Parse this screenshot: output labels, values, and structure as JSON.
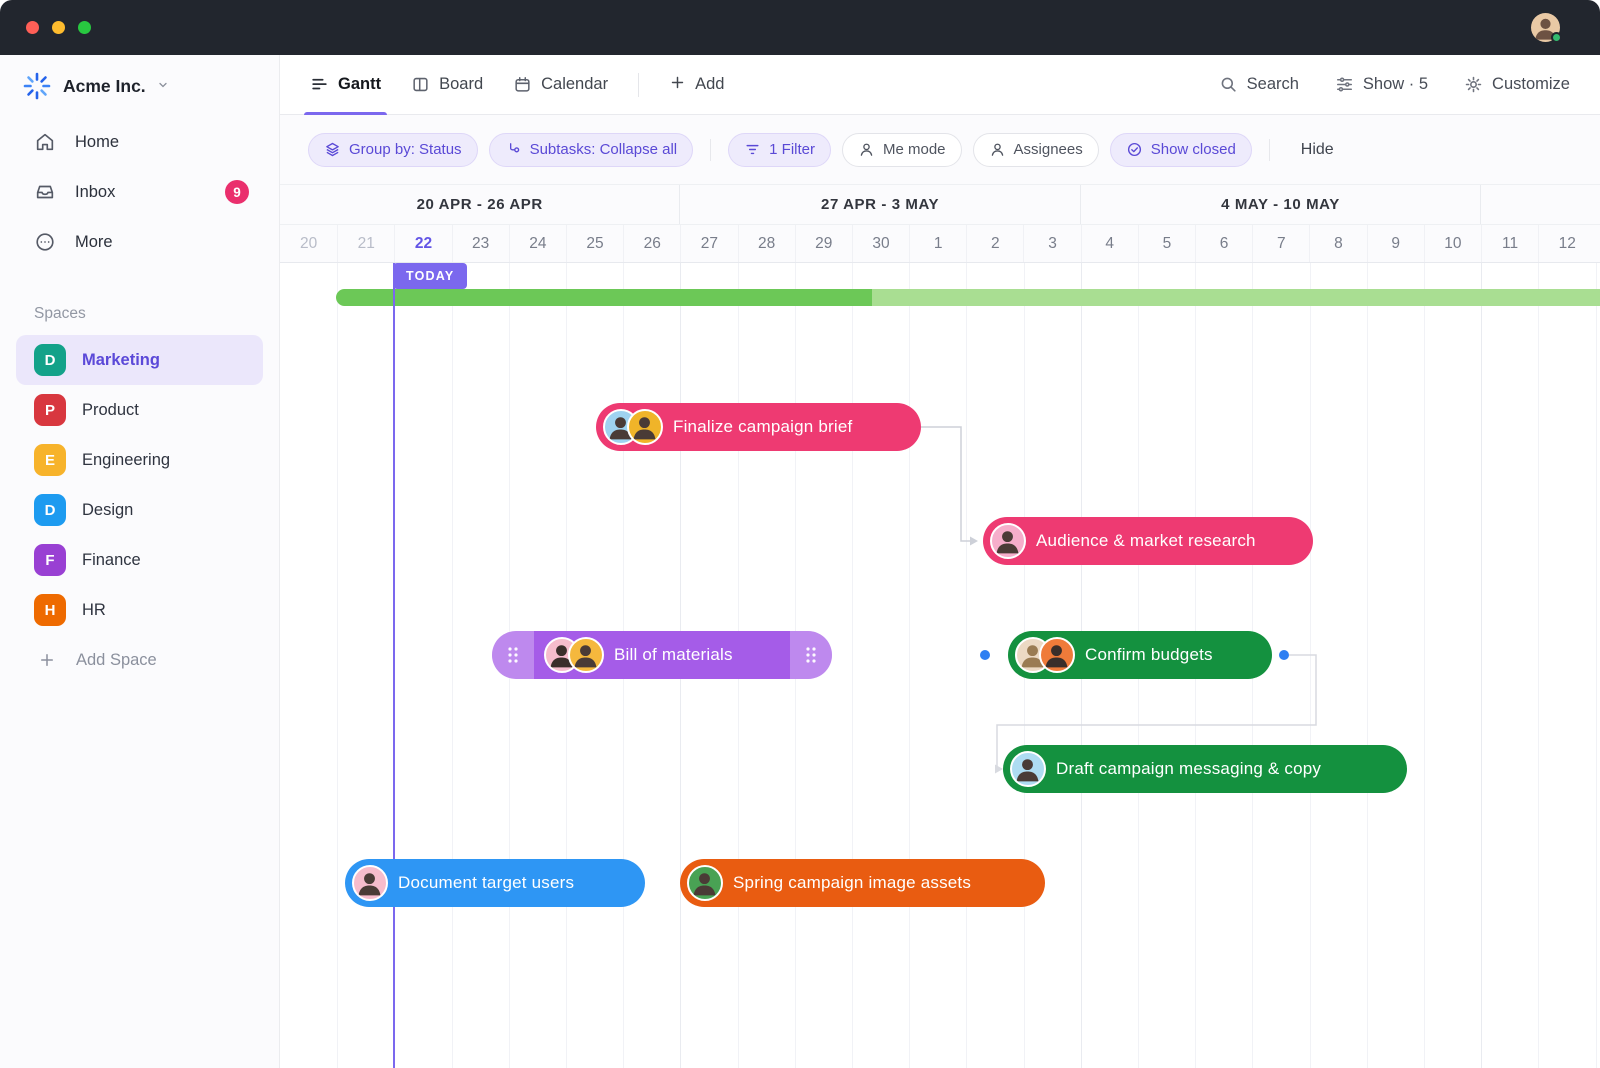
{
  "window": {
    "titlebar_color": "#22262e",
    "traffic_lights": [
      "close",
      "minimize",
      "zoom"
    ],
    "user": {
      "avatar_icon": "user-avatar",
      "online_status_color": "#34b96f"
    }
  },
  "sidebar": {
    "workspace_name": "Acme Inc.",
    "nav": [
      {
        "label": "Home",
        "icon": "home-icon"
      },
      {
        "label": "Inbox",
        "icon": "inbox-icon",
        "badge": "9"
      },
      {
        "label": "More",
        "icon": "ellipsis-circle-icon"
      }
    ],
    "spaces_heading": "Spaces",
    "spaces": [
      {
        "label": "Marketing",
        "initial": "D",
        "color": "#13a289",
        "selected": true
      },
      {
        "label": "Product",
        "initial": "P",
        "color": "#d8373f",
        "selected": false
      },
      {
        "label": "Engineering",
        "initial": "E",
        "color": "#f7b32b",
        "selected": false
      },
      {
        "label": "Design",
        "initial": "D",
        "color": "#1d9bf0",
        "selected": false
      },
      {
        "label": "Finance",
        "initial": "F",
        "color": "#9940d3",
        "selected": false
      },
      {
        "label": "HR",
        "initial": "H",
        "color": "#ee6a00",
        "selected": false
      }
    ],
    "add_space_label": "Add Space"
  },
  "toolbar": {
    "tabs": [
      {
        "label": "Gantt",
        "icon": "gantt-icon",
        "active": true
      },
      {
        "label": "Board",
        "icon": "board-icon",
        "active": false
      },
      {
        "label": "Calendar",
        "icon": "calendar-icon",
        "active": false
      }
    ],
    "add_label": "Add",
    "right_actions": [
      {
        "label": "Search",
        "icon": "search-icon"
      },
      {
        "label": "Show · 5",
        "icon": "sliders-icon"
      },
      {
        "label": "Customize",
        "icon": "gear-icon"
      }
    ]
  },
  "filterbar": {
    "pills": [
      {
        "label": "Group by: Status",
        "icon": "layers-icon",
        "style": "purple"
      },
      {
        "label": "Subtasks: Collapse all",
        "icon": "subtask-icon",
        "style": "purple"
      },
      {
        "label": "1 Filter",
        "icon": "filter-icon",
        "style": "purple"
      },
      {
        "label": "Me mode",
        "icon": "person-icon",
        "style": "neutral"
      },
      {
        "label": "Assignees",
        "icon": "person-icon",
        "style": "neutral"
      },
      {
        "label": "Show closed",
        "icon": "check-circle-icon",
        "style": "purple"
      }
    ],
    "hide_label": "Hide"
  },
  "gantt": {
    "weeks": [
      "20 APR - 26 APR",
      "27 APR - 3 MAY",
      "4 MAY - 10 MAY"
    ],
    "days": [
      "20",
      "21",
      "22",
      "23",
      "24",
      "25",
      "26",
      "27",
      "28",
      "29",
      "30",
      "1",
      "2",
      "3",
      "4",
      "5",
      "6",
      "7",
      "8",
      "9",
      "10",
      "11",
      "12"
    ],
    "past_days": [
      "20",
      "21"
    ],
    "today_day": "22",
    "today_label": "TODAY",
    "progress_colors": {
      "done": "#6cc857",
      "remaining": "#a9de92"
    },
    "tasks": [
      {
        "label": "Finalize campaign brief",
        "color": "#ee3a72",
        "assignees": 2
      },
      {
        "label": "Audience & market research",
        "color": "#ee3a72",
        "assignees": 1
      },
      {
        "label": "Bill of materials",
        "color": "#a55ce8",
        "assignees": 2,
        "drag_handles": true
      },
      {
        "label": "Confirm budgets",
        "color": "#14913f",
        "assignees": 2,
        "link_dots": true
      },
      {
        "label": "Draft campaign messaging & copy",
        "color": "#14913f",
        "assignees": 1
      },
      {
        "label": "Document target users",
        "color": "#2e96f4",
        "assignees": 1
      },
      {
        "label": "Spring campaign image assets",
        "color": "#e95c11",
        "assignees": 1
      }
    ],
    "today_color": "#7b68ee",
    "link_dot_color": "#2e7ff2"
  }
}
